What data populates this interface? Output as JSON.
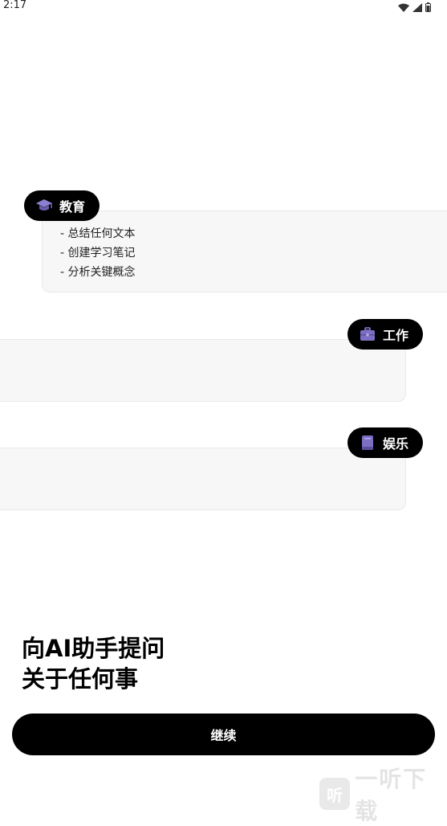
{
  "status_bar": {
    "time": "2:17",
    "icons": [
      "wifi-icon",
      "signal-icon",
      "battery-icon"
    ]
  },
  "categories": [
    {
      "label": "教育",
      "icon": "graduation-cap-icon",
      "items": [
        "- 总结任何文本",
        "- 创建学习笔记",
        "- 分析关键概念"
      ]
    },
    {
      "label": "工作",
      "icon": "briefcase-icon",
      "items": []
    },
    {
      "label": "娱乐",
      "icon": "book-icon",
      "items": []
    }
  ],
  "headline": {
    "line1": "向AI助手提问",
    "line2": "关于任何事"
  },
  "continue_label": "继续",
  "watermark": {
    "logo_char": "听",
    "text": "一听下载"
  },
  "colors": {
    "background": "#ffffff",
    "card": "#f7f7f7",
    "pill": "#000000",
    "icon_accent": "#7b6fc4"
  }
}
